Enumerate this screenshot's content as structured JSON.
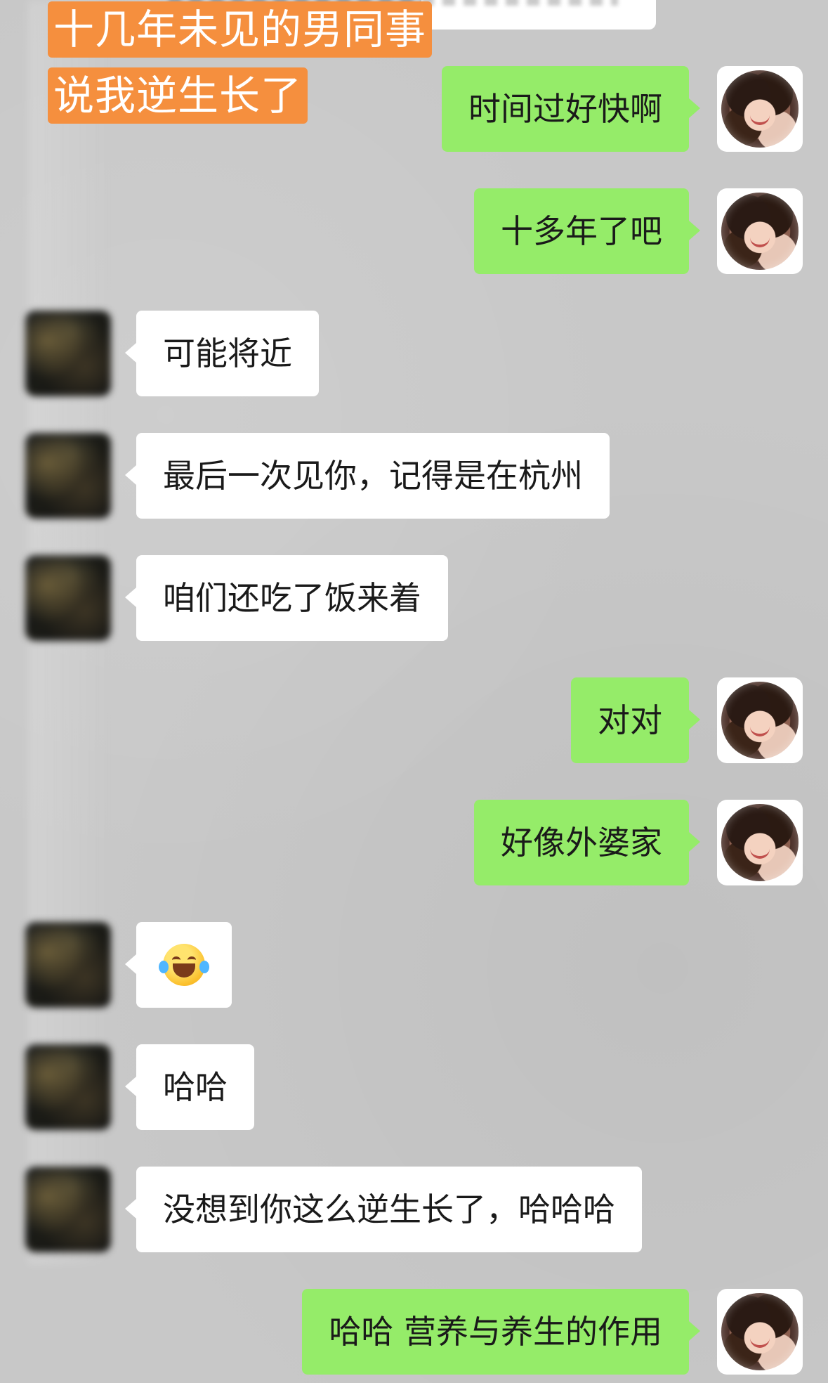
{
  "caption": {
    "line1": "十几年未见的男同事",
    "line2": "说我逆生长了"
  },
  "messages": [
    {
      "sender": "me",
      "text": "时间过好快啊"
    },
    {
      "sender": "me",
      "text": "十多年了吧"
    },
    {
      "sender": "other",
      "text": "可能将近"
    },
    {
      "sender": "other",
      "text": "最后一次见你，记得是在杭州"
    },
    {
      "sender": "other",
      "text": "咱们还吃了饭来着"
    },
    {
      "sender": "me",
      "text": "对对"
    },
    {
      "sender": "me",
      "text": "好像外婆家"
    },
    {
      "sender": "other",
      "emoji": "tears-of-joy"
    },
    {
      "sender": "other",
      "text": "哈哈"
    },
    {
      "sender": "other",
      "text": "没想到你这么逆生长了，哈哈哈"
    },
    {
      "sender": "me",
      "text": "哈哈 营养与养生的作用"
    }
  ],
  "colors": {
    "background": "#c8c8c8",
    "me_bubble": "#95ec69",
    "other_bubble": "#ffffff",
    "caption_bg": "#f58f3e",
    "caption_text": "#ffffff"
  },
  "icons": {
    "my_avatar": "avatar-photo",
    "other_avatar": "avatar-blurred",
    "emoji": "face-with-tears-of-joy"
  }
}
